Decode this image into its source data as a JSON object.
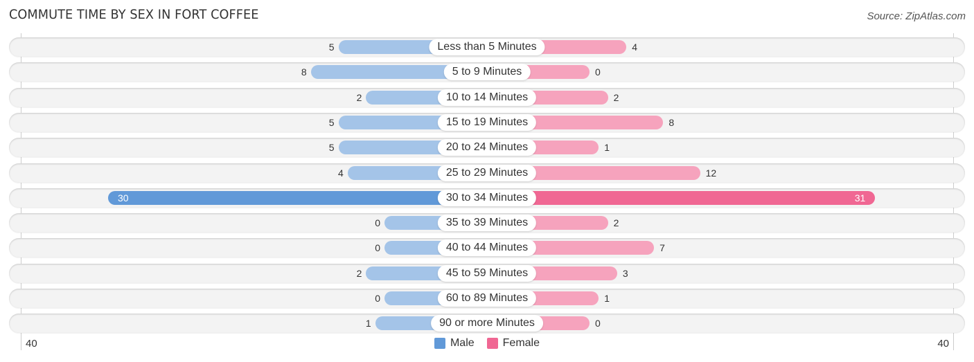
{
  "chart_data": {
    "type": "bar",
    "orientation": "horizontal-diverging",
    "title": "COMMUTE TIME BY SEX IN FORT COFFEE",
    "source": "Source: ZipAtlas.com",
    "categories": [
      "Less than 5 Minutes",
      "5 to 9 Minutes",
      "10 to 14 Minutes",
      "15 to 19 Minutes",
      "20 to 24 Minutes",
      "25 to 29 Minutes",
      "30 to 34 Minutes",
      "35 to 39 Minutes",
      "40 to 44 Minutes",
      "45 to 59 Minutes",
      "60 to 89 Minutes",
      "90 or more Minutes"
    ],
    "series": [
      {
        "name": "Male",
        "color": "#6199d8",
        "values": [
          5,
          8,
          2,
          5,
          5,
          4,
          30,
          0,
          0,
          2,
          0,
          1
        ]
      },
      {
        "name": "Female",
        "color": "#f06793",
        "values": [
          4,
          0,
          2,
          8,
          1,
          12,
          31,
          2,
          7,
          3,
          1,
          0
        ]
      }
    ],
    "axis": {
      "left_tick": "40",
      "right_tick": "40",
      "max": 40
    },
    "legend": {
      "position": "bottom-center",
      "items": [
        "Male",
        "Female"
      ]
    },
    "light_colors": {
      "male": "#a4c4e8",
      "female": "#f6a3bd"
    }
  }
}
